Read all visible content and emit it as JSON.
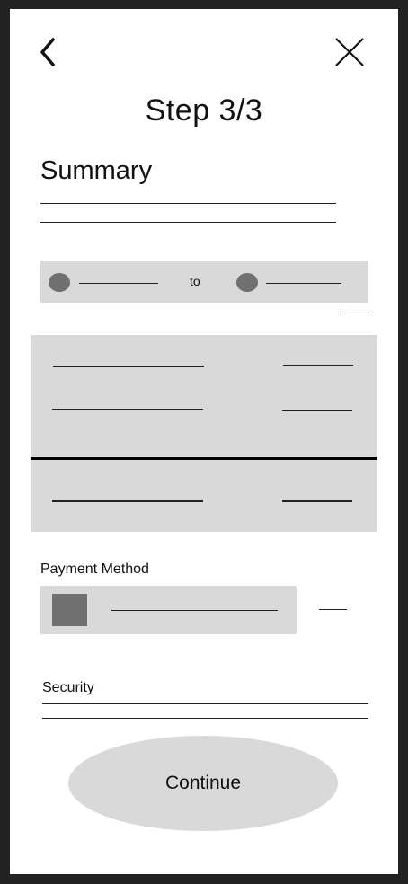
{
  "header": {
    "back_icon": "chevron-left-icon",
    "close_icon": "close-x-icon",
    "step_title": "Step 3/3"
  },
  "summary": {
    "title": "Summary"
  },
  "route": {
    "connector": "to"
  },
  "payment": {
    "label": "Payment Method"
  },
  "security": {
    "label": "Security"
  },
  "actions": {
    "continue_label": "Continue"
  },
  "colors": {
    "placeholder_fill": "#d9d9d9",
    "marker_fill": "#707070",
    "line": "#222222",
    "background": "#ffffff",
    "frame": "#222222"
  }
}
